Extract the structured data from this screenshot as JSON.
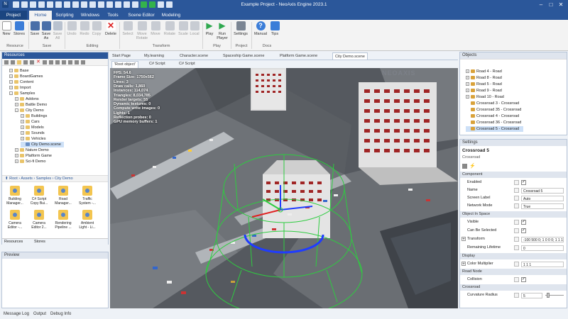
{
  "window": {
    "title": "Example Project - NeoAxis Engine 2023.1",
    "min": "–",
    "max": "□",
    "close": "✕"
  },
  "ribbon_tabs": [
    "Project",
    "Home",
    "Scripting",
    "Windows",
    "Tools",
    "Scene Editor",
    "Modeling"
  ],
  "ribbon": {
    "buttons": {
      "new": "New",
      "stores": "Stores",
      "save": "Save",
      "save_as": "Save As",
      "save_all": "Save All",
      "undo": "Undo",
      "redo": "Redo",
      "copy": "Copy",
      "delete": "Delete",
      "select": "Select",
      "move_rotate": "Move Rotate",
      "move": "Move",
      "rotate": "Rotate",
      "scale": "Scale",
      "local": "Local",
      "play": "Play",
      "run_player": "Run Player",
      "settings": "Settings",
      "manual": "Manual",
      "tips": "Tips"
    },
    "groups": {
      "resource": "Resource",
      "save": "Save",
      "editing": "Editing",
      "transform": "Transform",
      "play": "Play",
      "project": "Project",
      "docs": "Docs"
    }
  },
  "resources": {
    "title": "Resources",
    "tree": [
      "Base",
      "BoardGames",
      "Content",
      "Import",
      "Samples",
      "Addons",
      "Battle Demo",
      "City Demo",
      "Buildings",
      "Cars",
      "Models",
      "Sounds",
      "Vehicles",
      "City Demo.scene",
      "Nature Demo",
      "Platform Game",
      "Sci-fi Demo"
    ],
    "breadcrumb": "Root › Assets › Samples › City Demo",
    "tiles": [
      "Building Manager...",
      "C# Script Copy Bui...",
      "Road Manager...",
      "Traffic System -...",
      "Camera Editor -...",
      "Camera Editor 2...",
      "Rendering Pipeline ...",
      "Ambient Light - Li..."
    ],
    "bottom_tabs": [
      "Resources",
      "Stores"
    ]
  },
  "preview": {
    "title": "Preview"
  },
  "doc_tabs": [
    "Start Page",
    "My.learning",
    "Character.scene",
    "Spaceship Game.scene",
    "Platform Game.scene",
    "City Demo.scene"
  ],
  "sub_tabs": [
    "'Root object'",
    "C# Script",
    "C# Script"
  ],
  "viewport": {
    "stats": [
      "FPS: 54.6",
      "Frame Size: 1750x562",
      "Lines: 3",
      "Draw calls: 1,860",
      "Instances: 114,074",
      "Triangles: 8,034,785",
      "Render targets: 55",
      "Dynamic textures: 0",
      "Compute write images: 0",
      "Lights: 1",
      "Reflection probes: 0",
      "GPU memory buffers: 1"
    ],
    "watermark": "NEOAXIS"
  },
  "objects": {
    "title": "Objects",
    "items": [
      "Road 4 - Road",
      "Road 8 - Road",
      "Road 5 - Road",
      "Road 9 - Road",
      "Road 10 - Road",
      "Crossroad 3 - Crossroad",
      "Crossroad 35 - Crossroad",
      "Crossroad 4 - Crossroad",
      "Crossroad 36 - Crossroad",
      "Crossroad 5 - Crossroad"
    ]
  },
  "settings": {
    "title": "Settings",
    "object_name": "Crossroad 5",
    "object_type": "Crossroad",
    "sections": {
      "component": {
        "label": "Component",
        "rows": [
          {
            "label": "Enabled",
            "check": true
          },
          {
            "label": "Name",
            "value": "Crossroad 5"
          },
          {
            "label": "Screen Label",
            "value": "Auto"
          },
          {
            "label": "Network Mode",
            "value": "True"
          }
        ]
      },
      "object_in_space": {
        "label": "Object In Space",
        "rows": [
          {
            "label": "Visible",
            "check": true
          },
          {
            "label": "Can Be Selected",
            "check": true
          },
          {
            "label": "Transform",
            "value": "-100 500 0; 1 0 0 0; 1 1 1"
          },
          {
            "label": "Remaining Lifetime",
            "value": "0"
          }
        ]
      },
      "display": {
        "label": "Display",
        "rows": [
          {
            "label": "Color Multiplier",
            "value": "1 1 1"
          }
        ]
      },
      "road_node": {
        "label": "Road Node",
        "rows": [
          {
            "label": "Collision",
            "check": true
          }
        ]
      },
      "crossroad": {
        "label": "Crossroad",
        "rows": [
          {
            "label": "Curvature Radius",
            "value": "5"
          }
        ]
      }
    }
  },
  "bottom_tabs": [
    "Message Log",
    "Output",
    "Debug Info"
  ],
  "colors": {
    "accent": "#2b579a",
    "gizmo_green": "#2ecc40",
    "gizmo_blue": "#1f3cff",
    "gizmo_red": "#e02020"
  }
}
